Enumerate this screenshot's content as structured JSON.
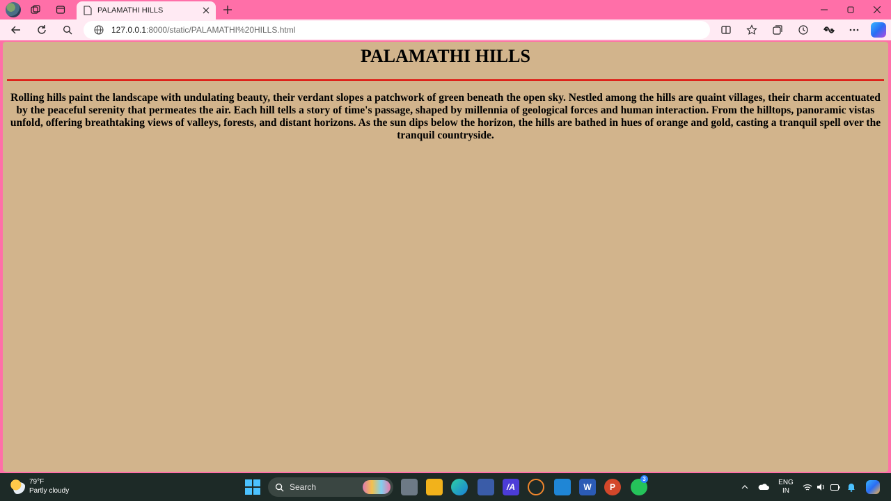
{
  "browser": {
    "tab_title": "PALAMATHI HILLS",
    "url_host": "127.0.0.1",
    "url_rest": ":8000/static/PALAMATHI%20HILLS.html"
  },
  "page": {
    "heading": "PALAMATHI HILLS",
    "paragraph": "Rolling hills paint the landscape with undulating beauty, their verdant slopes a patchwork of green beneath the open sky. Nestled among the hills are quaint villages, their charm accentuated by the peaceful serenity that permeates the air. Each hill tells a story of time's passage, shaped by millennia of geological forces and human interaction. From the hilltops, panoramic vistas unfold, offering breathtaking views of valleys, forests, and distant horizons. As the sun dips below the horizon, the hills are bathed in hues of orange and gold, casting a tranquil spell over the tranquil countryside.",
    "background_color": "#d2b48c",
    "rule_color": "#e00000"
  },
  "taskbar": {
    "weather_temp": "79°F",
    "weather_desc": "Partly cloudy",
    "search_label": "Search",
    "whatsapp_badge": "3",
    "lang_top": "ENG",
    "lang_bottom": "IN"
  },
  "colors": {
    "chrome_accent": "#ff6fa8",
    "chrome_light": "#ffeaf3",
    "taskbar": "#1d2a27"
  }
}
